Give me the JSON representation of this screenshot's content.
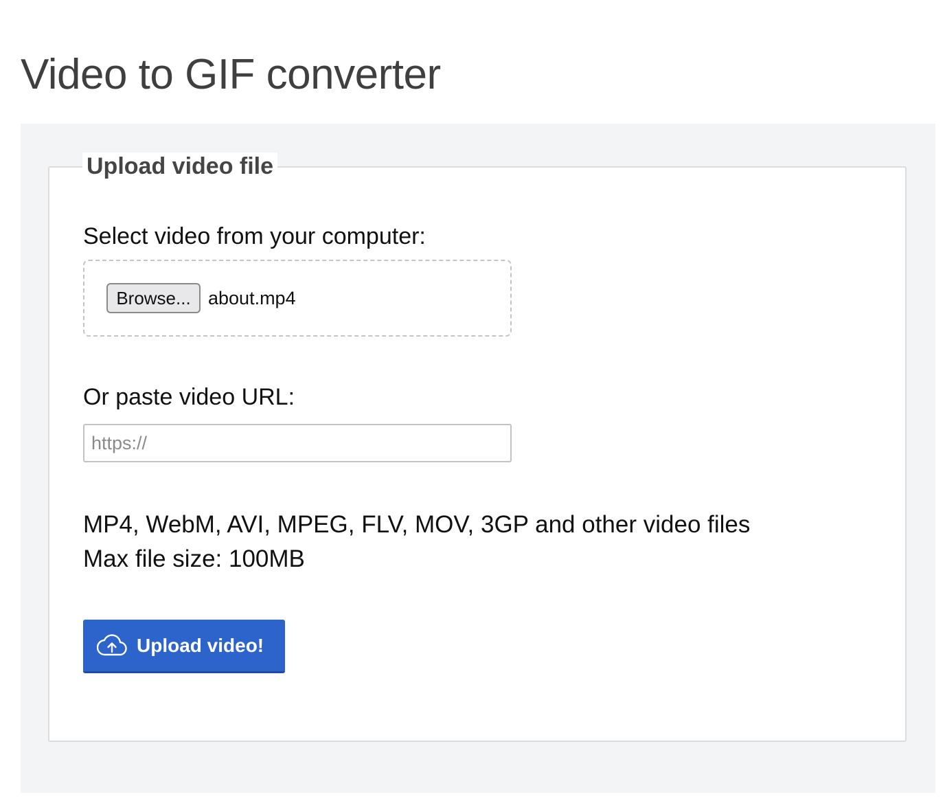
{
  "page": {
    "title": "Video to GIF converter"
  },
  "upload_form": {
    "legend": "Upload video file",
    "file_section": {
      "label": "Select video from your computer:",
      "browse_label": "Browse...",
      "selected_file": "about.mp4"
    },
    "url_section": {
      "label": "Or paste video URL:",
      "placeholder": "https://",
      "value": ""
    },
    "info": {
      "formats": "MP4, WebM, AVI, MPEG, FLV, MOV, 3GP and other video files",
      "max_size": "Max file size: 100MB"
    },
    "submit": {
      "label": "Upload video!",
      "icon": "cloud-upload-icon"
    }
  },
  "colors": {
    "accent": "#2d64cc",
    "panel_background": "#f3f4f6",
    "title_text": "#3f3f3f"
  }
}
